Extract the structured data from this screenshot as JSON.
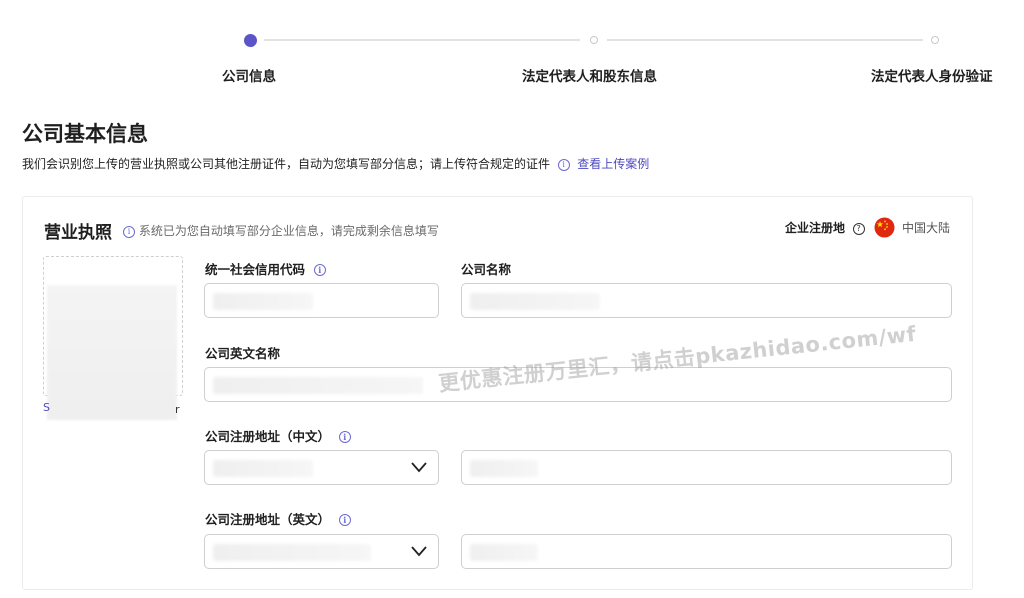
{
  "stepper": {
    "steps": [
      {
        "label": "公司信息",
        "active": true
      },
      {
        "label": "法定代表人和股东信息",
        "active": false
      },
      {
        "label": "法定代表人身份验证",
        "active": false
      }
    ],
    "accent_color": "#5b55c8"
  },
  "page": {
    "title": "公司基本信息",
    "subtitle": "我们会识别您上传的营业执照或公司其他注册证件，自动为您填写部分信息；请上传符合规定的证件",
    "example_link": "查看上传案例"
  },
  "license_section": {
    "title": "营业执照",
    "hint": "系统已为您自动填写部分企业信息，请完成剩余信息填写",
    "region_label": "企业注册地",
    "region_value": "中国大陆",
    "upload_link_fragment": "S",
    "upload_tail_fragment": "r"
  },
  "fields": {
    "credit_code_label": "统一社会信用代码",
    "company_name_label": "公司名称",
    "english_name_label": "公司英文名称",
    "address_cn_label": "公司注册地址（中文）",
    "address_en_label": "公司注册地址（英文）"
  },
  "watermark": "更优惠注册万里汇，请点击pkazhidao.com/wf"
}
